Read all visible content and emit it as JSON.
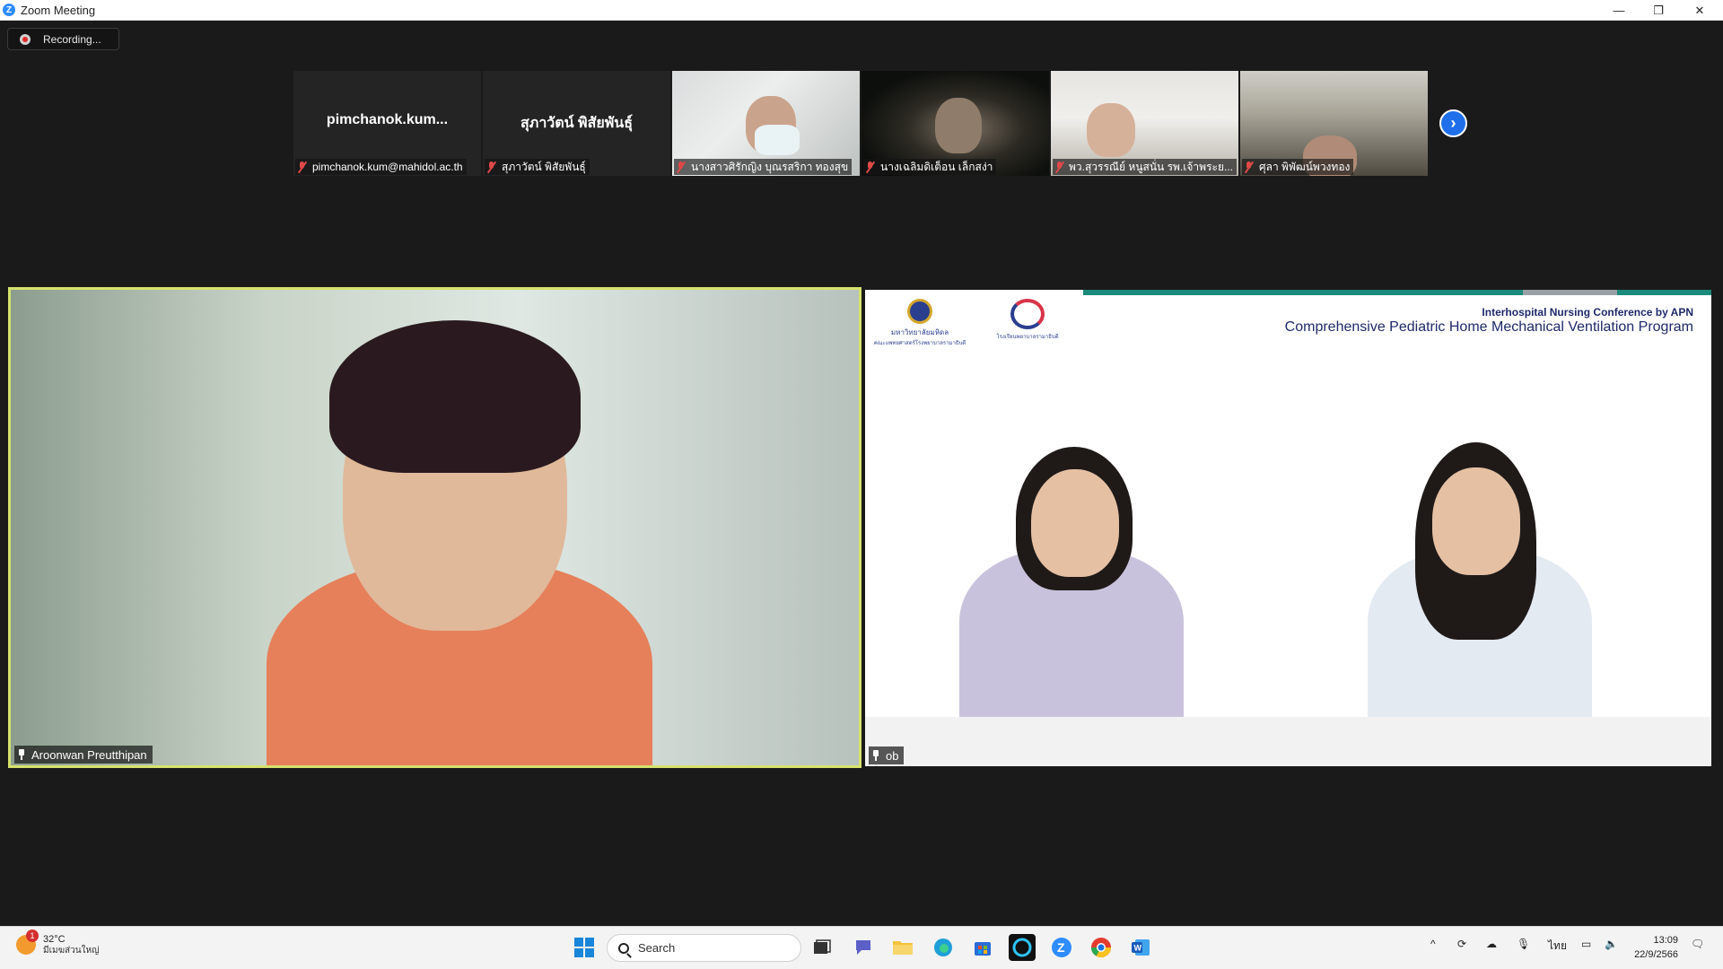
{
  "window": {
    "title": "Zoom Meeting",
    "minimize": "—",
    "restore": "❐",
    "close": "✕"
  },
  "recording": {
    "label": "Recording..."
  },
  "thumbnails": [
    {
      "display_name": "pimchanok.kum...",
      "label": "pimchanok.kum@mahidol.ac.th",
      "video": false
    },
    {
      "display_name": "สุภาวัตน์ พิสัยพันธ์ุ",
      "label": "สุภาวัตน์ พิสัยพันธ์ุ",
      "video": false
    },
    {
      "display_name": "",
      "label": "นางสาวศิรักญิง บุณรสริกา ทองสุข",
      "video": true
    },
    {
      "display_name": "",
      "label": "นางเฉลิมดิเต็อน เล็กสง่า",
      "video": true
    },
    {
      "display_name": "",
      "label": "พว.สุวรรณีย์ หนูสนั่น รพ.เจ้าพระย...",
      "video": true
    },
    {
      "display_name": "",
      "label": "ศุลา พิพัฒน์พวงทอง",
      "video": true
    }
  ],
  "next_page_icon": "chevron-right",
  "main": {
    "left_speaker": "Aroonwan Preutthipan",
    "right_speaker": "ob",
    "slide": {
      "logo1_line1": "มหาวิทยาลัยมหิดล",
      "logo1_line2": "คณะแพทยศาสตร์โรงพยาบาลรามาธิบดี",
      "logo2_line1": "โรงเรียนพยาบาลรามาธิบดี",
      "subtitle": "Interhospital Nursing Conference by APN",
      "title": "Comprehensive Pediatric Home Mechanical Ventilation Program"
    }
  },
  "taskbar": {
    "weather_badge": "1",
    "temperature": "32°C",
    "condition": "มีเมฆส่วนใหญ่",
    "search_placeholder": "Search",
    "language": "ไทย",
    "time": "13:09",
    "date": "22/9/2566"
  },
  "colors": {
    "active_speaker_border": "#d6e26c",
    "zoom_blue": "#2d8cff",
    "muted_red": "#e04848"
  }
}
